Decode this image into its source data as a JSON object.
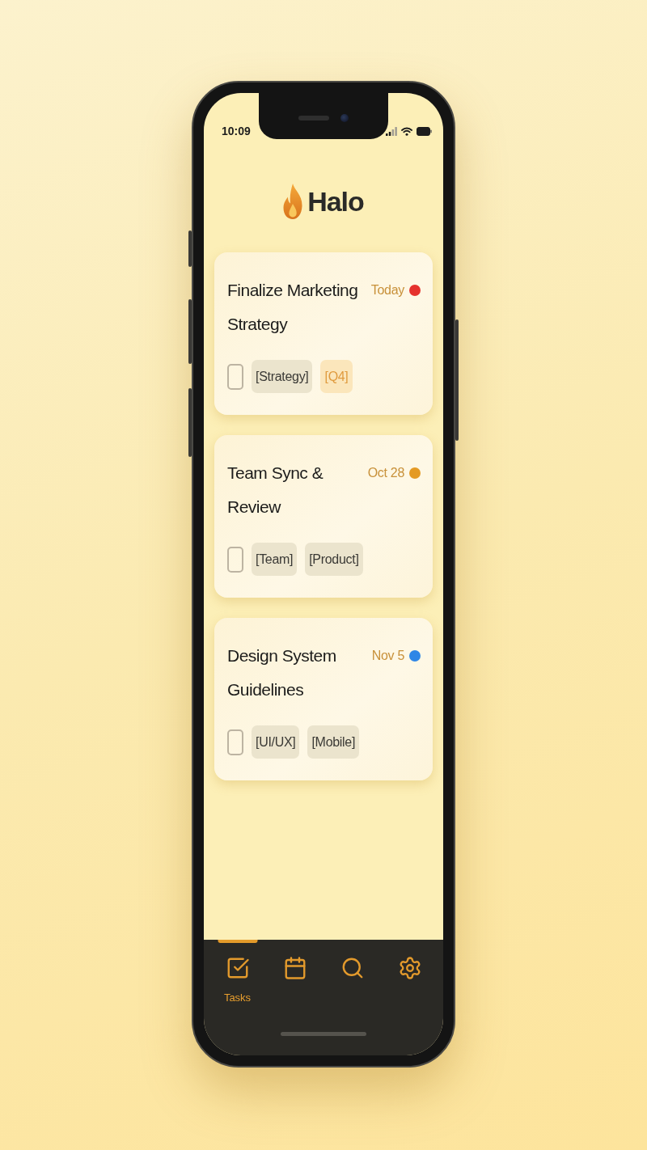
{
  "status_bar": {
    "time": "10:09"
  },
  "header": {
    "title": "Halo"
  },
  "tasks": [
    {
      "title": "Finalize Marketing Strategy",
      "due": "Today",
      "color": "#e5322d",
      "checked": false,
      "tags": [
        {
          "label": "[Strategy]",
          "kind": "plain"
        },
        {
          "label": "[Q4]",
          "kind": "accent"
        }
      ]
    },
    {
      "title": "Team Sync & Review",
      "due": "Oct 28",
      "color": "#e49a24",
      "checked": false,
      "tags": [
        {
          "label": "[Team]",
          "kind": "plain"
        },
        {
          "label": "[Product]",
          "kind": "plain"
        }
      ]
    },
    {
      "title": "Design System Guidelines",
      "due": "Nov 5",
      "color": "#2f86e6",
      "checked": false,
      "tags": [
        {
          "label": "[UI/UX]",
          "kind": "plain"
        },
        {
          "label": "[Mobile]",
          "kind": "plain"
        }
      ]
    }
  ],
  "tab_bar": {
    "tabs": [
      {
        "kind": "tasks",
        "label": "Tasks",
        "selected": true
      },
      {
        "kind": "calendar",
        "selected": false
      },
      {
        "kind": "search",
        "selected": false
      },
      {
        "kind": "settings",
        "selected": false
      }
    ]
  }
}
